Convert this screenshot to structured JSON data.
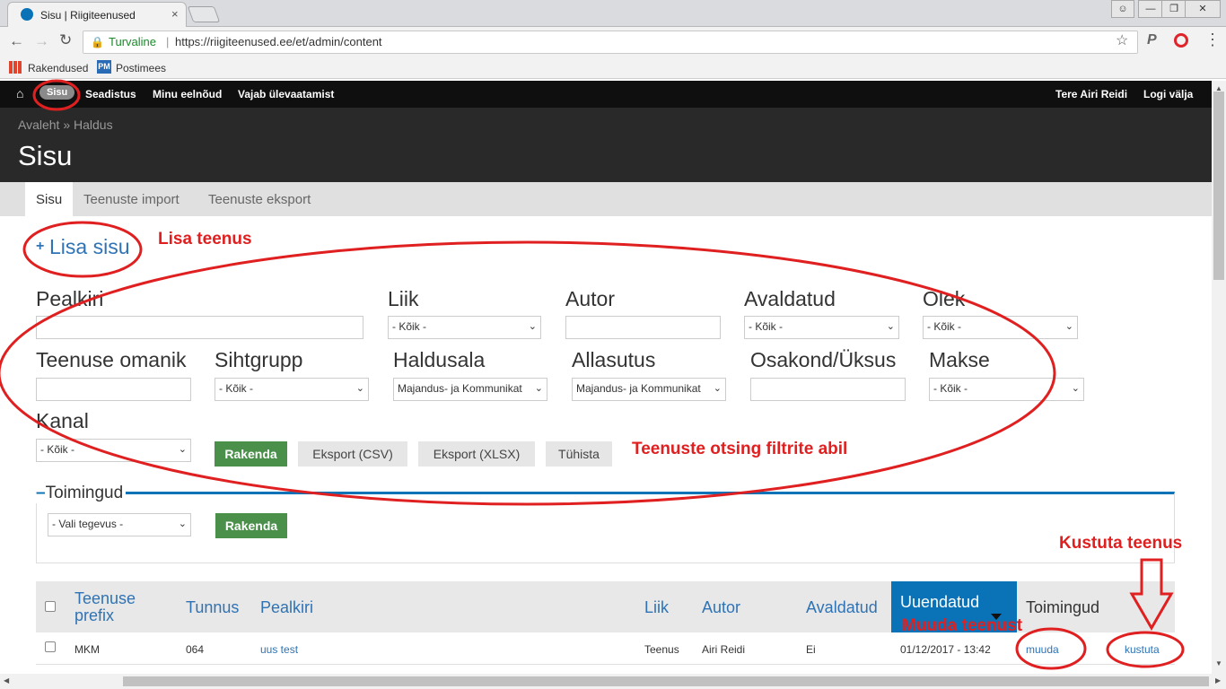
{
  "browser": {
    "tab_title": "Sisu | Riigiteenused",
    "tab_close": "×",
    "secure_label": "Turvaline",
    "url": "https://riigiteenused.ee/et/admin/content",
    "bookmarks": [
      "Rakendused",
      "Postimees"
    ]
  },
  "toolbar": {
    "items": [
      "Sisu",
      "Seadistus",
      "Minu eelnõud",
      "Vajab ülevaatamist"
    ],
    "greeting": "Tere ",
    "user": "Airi Reidi",
    "logout": "Logi välja"
  },
  "header": {
    "breadcrumb": "Avaleht » Haldus",
    "title": "Sisu"
  },
  "tabs": [
    "Sisu",
    "Teenuste import",
    "Teenuste eksport"
  ],
  "add_content": {
    "icon": "+",
    "label": "Lisa sisu"
  },
  "filters": {
    "title_label": "Pealkiri",
    "type_label": "Liik",
    "type_value": "- Kõik -",
    "author_label": "Autor",
    "published_label": "Avaldatud",
    "published_value": "- Kõik -",
    "state_label": "Olek",
    "state_value": "- Kõik -",
    "owner_label": "Teenuse omanik",
    "target_label": "Sihtgrupp",
    "target_value": "- Kõik -",
    "domain_label": "Haldusala",
    "domain_value": "Majandus- ja Kommunikat",
    "agency_label": "Allasutus",
    "agency_value": "Majandus- ja Kommunikat",
    "dept_label": "Osakond/Üksus",
    "fee_label": "Makse",
    "fee_value": "- Kõik -",
    "channel_label": "Kanal",
    "channel_value": "- Kõik -",
    "apply": "Rakenda",
    "export_csv": "Eksport (CSV)",
    "export_xlsx": "Eksport (XLSX)",
    "reset": "Tühista"
  },
  "actions": {
    "legend": "Toimingud",
    "select_value": "- Vali tegevus -",
    "apply": "Rakenda"
  },
  "table": {
    "headers": {
      "prefix": "Teenuse prefix",
      "code": "Tunnus",
      "title": "Pealkiri",
      "type": "Liik",
      "author": "Autor",
      "published": "Avaldatud",
      "updated": "Uuendatud",
      "operations": "Toimingud"
    },
    "rows": [
      {
        "prefix": "MKM",
        "code": "064",
        "title": "uus test",
        "type": "Teenus",
        "author": "Airi Reidi",
        "published": "Ei",
        "updated": "01/12/2017 - 13:42",
        "edit": "muuda",
        "delete": "kustuta"
      }
    ]
  },
  "annotations": {
    "add": "Lisa teenus",
    "filter": "Teenuste otsing filtrite abil",
    "delete": "Kustuta teenus",
    "edit": "Muuda teenust",
    "color": "#e02020"
  }
}
